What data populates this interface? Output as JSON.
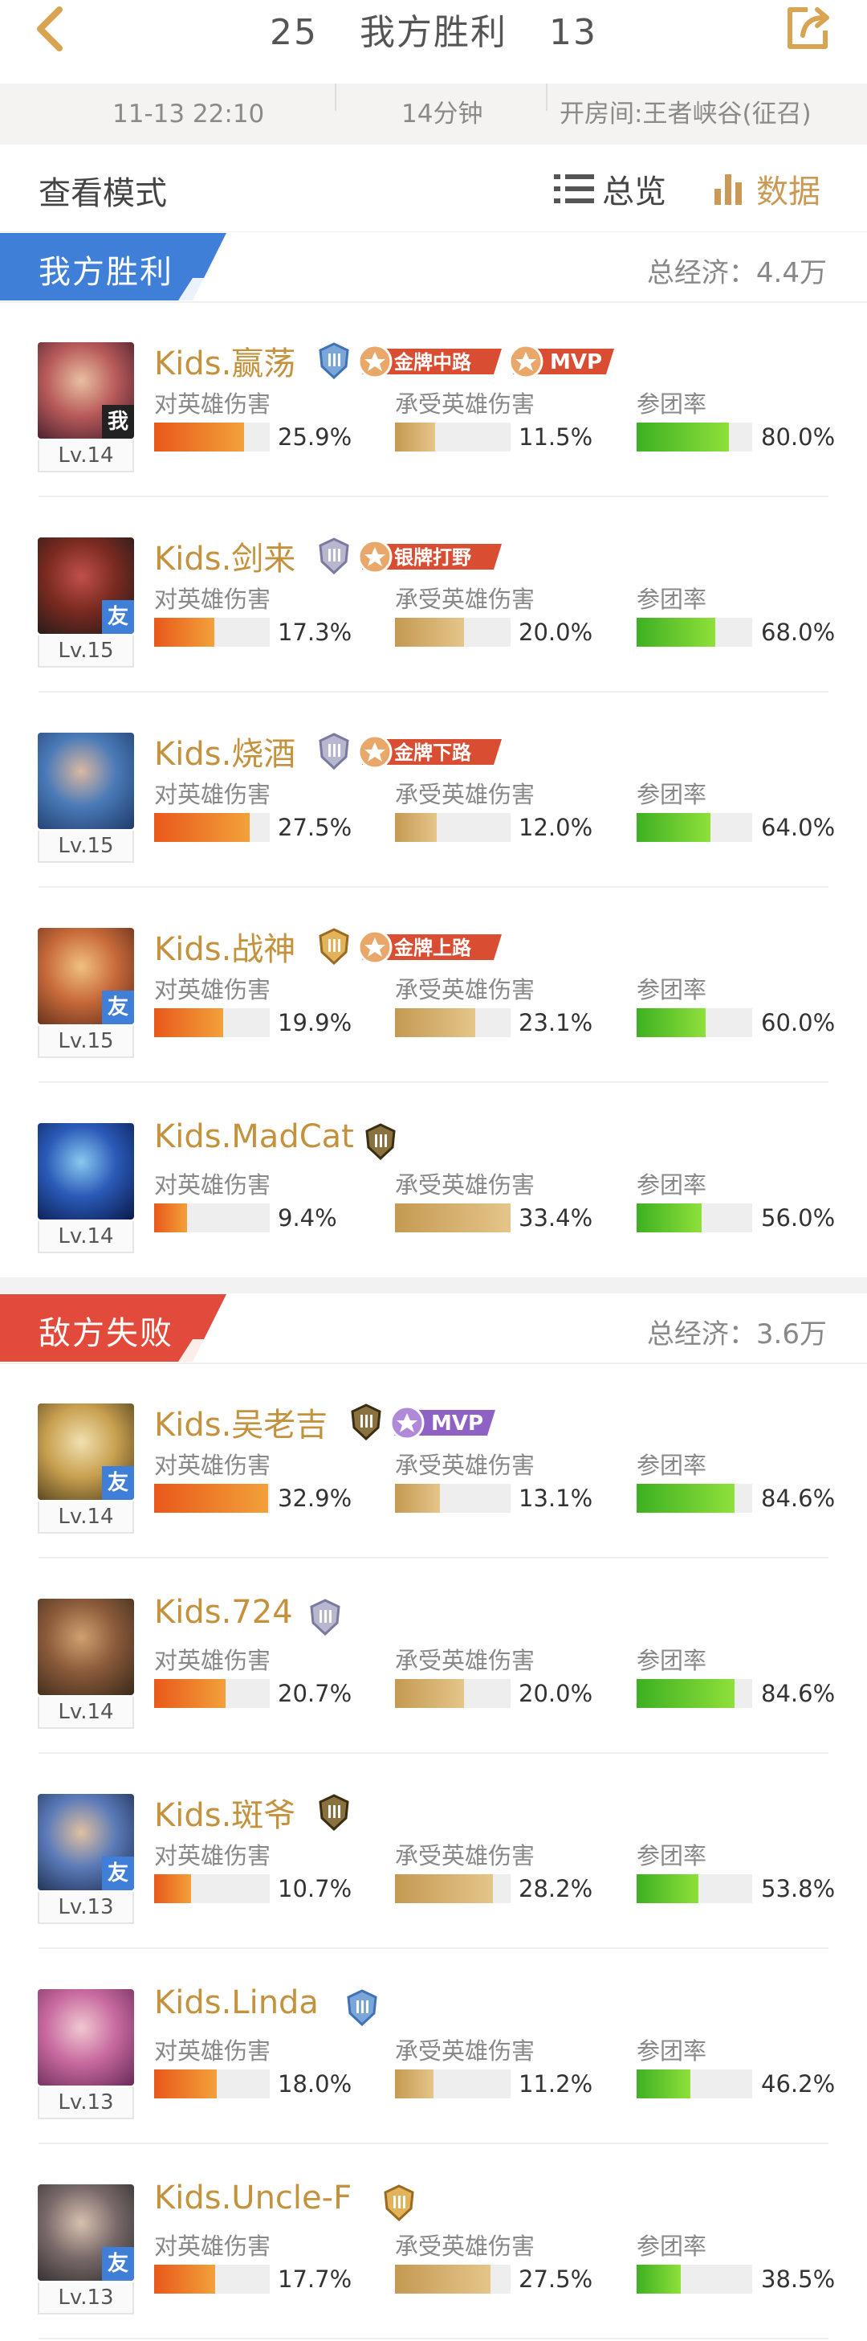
{
  "header": {
    "our_kills": "25",
    "result_title": "我方胜利",
    "enemy_kills": "13"
  },
  "info": {
    "datetime": "11-13 22:10",
    "duration": "14分钟",
    "mode": "开房间:王者峡谷(征召)"
  },
  "modebar": {
    "label": "查看模式",
    "overview": "总览",
    "data": "数据"
  },
  "stat_labels": {
    "damage_dealt": "对英雄伤害",
    "damage_taken": "承受英雄伤害",
    "participation": "参团率"
  },
  "colors": {
    "win": "#3f7fd8",
    "lose": "#e24b3b",
    "name_gold": "#c4913d",
    "mvp_win": "#d94e32",
    "mvp_lose": "#8e62c4"
  },
  "our_team": {
    "title": "我方胜利",
    "economy": "总经济：4.4万",
    "players": [
      {
        "name": "Kids.赢荡",
        "level": "Lv.14",
        "tag": "我",
        "rank_icon": "rank-badge-diamond-icon",
        "medals": [
          "金牌中路",
          "MVP"
        ],
        "dmg": "25.9%",
        "take": "11.5%",
        "team": "80.0%",
        "dmg_v": 25.9,
        "take_v": 11.5,
        "team_v": 80.0,
        "bg": [
          "#3b1a2a",
          "#b85a5a",
          "#e8c0a0"
        ]
      },
      {
        "name": "Kids.剑来",
        "level": "Lv.15",
        "tag": "友",
        "rank_icon": "rank-badge-silver-icon",
        "medals": [
          "银牌打野"
        ],
        "dmg": "17.3%",
        "take": "20.0%",
        "team": "68.0%",
        "dmg_v": 17.3,
        "take_v": 20.0,
        "team_v": 68.0,
        "bg": [
          "#1a1a1a",
          "#7a2a20",
          "#c0504a"
        ]
      },
      {
        "name": "Kids.烧酒",
        "level": "Lv.15",
        "tag": "",
        "rank_icon": "rank-badge-silver-icon",
        "medals": [
          "金牌下路"
        ],
        "dmg": "27.5%",
        "take": "12.0%",
        "team": "64.0%",
        "dmg_v": 27.5,
        "take_v": 12.0,
        "team_v": 64.0,
        "bg": [
          "#1f3b6a",
          "#4a7ab8",
          "#d8b8a0"
        ]
      },
      {
        "name": "Kids.战神",
        "level": "Lv.15",
        "tag": "友",
        "rank_icon": "rank-badge-gold-icon",
        "medals": [
          "金牌上路"
        ],
        "dmg": "19.9%",
        "take": "23.1%",
        "team": "60.0%",
        "dmg_v": 19.9,
        "take_v": 23.1,
        "team_v": 60.0,
        "bg": [
          "#5a2a1a",
          "#c86a3a",
          "#f0c080"
        ]
      },
      {
        "name": "Kids.MadCat",
        "level": "Lv.14",
        "tag": "",
        "rank_icon": "rank-badge-king-icon",
        "medals": [],
        "dmg": "9.4%",
        "take": "33.4%",
        "team": "56.0%",
        "dmg_v": 9.4,
        "take_v": 33.4,
        "team_v": 56.0,
        "bg": [
          "#0a1a4a",
          "#2a5ab8",
          "#8ac8f0"
        ]
      }
    ]
  },
  "enemy_team": {
    "title": "敌方失败",
    "economy": "总经济：3.6万",
    "players": [
      {
        "name": "Kids.吴老吉",
        "level": "Lv.14",
        "tag": "友",
        "rank_icon": "rank-badge-king-icon",
        "medals": [
          "MVP"
        ],
        "dmg": "32.9%",
        "take": "13.1%",
        "team": "84.6%",
        "dmg_v": 32.9,
        "take_v": 13.1,
        "team_v": 84.6,
        "bg": [
          "#4a3a1a",
          "#c8a050",
          "#f0e0b0"
        ]
      },
      {
        "name": "Kids.724",
        "level": "Lv.14",
        "tag": "",
        "rank_icon": "rank-badge-silver-icon",
        "medals": [],
        "dmg": "20.7%",
        "take": "20.0%",
        "team": "84.6%",
        "dmg_v": 20.7,
        "take_v": 20.0,
        "team_v": 84.6,
        "bg": [
          "#3a2a1a",
          "#8a5a3a",
          "#d0a070"
        ]
      },
      {
        "name": "Kids.斑爷",
        "level": "Lv.13",
        "tag": "友",
        "rank_icon": "rank-badge-king-icon",
        "medals": [],
        "dmg": "10.7%",
        "take": "28.2%",
        "team": "53.8%",
        "dmg_v": 10.7,
        "take_v": 28.2,
        "team_v": 53.8,
        "bg": [
          "#1a2a4a",
          "#5a7ab8",
          "#e0c0a0"
        ]
      },
      {
        "name": "Kids.Linda",
        "level": "Lv.13",
        "tag": "",
        "rank_icon": "rank-badge-diamond-icon",
        "medals": [],
        "dmg": "18.0%",
        "take": "11.2%",
        "team": "46.2%",
        "dmg_v": 18.0,
        "take_v": 11.2,
        "team_v": 46.2,
        "bg": [
          "#6a2a5a",
          "#c86aa0",
          "#f0c8d0"
        ]
      },
      {
        "name": "Kids.Uncle-F",
        "level": "Lv.13",
        "tag": "友",
        "rank_icon": "rank-badge-gold-icon",
        "medals": [],
        "dmg": "17.7%",
        "take": "27.5%",
        "team": "38.5%",
        "dmg_v": 17.7,
        "take_v": 27.5,
        "team_v": 38.5,
        "bg": [
          "#2a2a2a",
          "#7a6a6a",
          "#d8c0b0"
        ]
      }
    ]
  }
}
